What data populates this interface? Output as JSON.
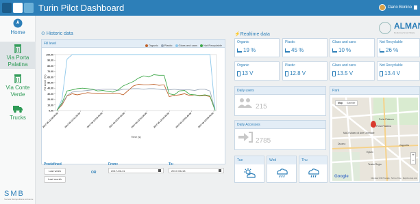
{
  "app": {
    "title": "Turin Pilot Dashboard",
    "user_name": "Dario Bonino"
  },
  "sidebar": {
    "items": [
      {
        "label": "Home",
        "icon": "compass-icon"
      },
      {
        "label": "Via Porta Palatina",
        "icon": "trash-bin-icon"
      },
      {
        "label": "Via Conte Verde",
        "icon": "trash-bin-icon"
      },
      {
        "label": "Trucks",
        "icon": "truck-icon"
      }
    ],
    "footer_logo": "SMB",
    "footer_tagline": "Società Metropolitana Ambiente"
  },
  "historic": {
    "section_title": "Historic data",
    "panel_title": "Fill level",
    "predefined_label": "Predefined",
    "btn_last_week": "Last week",
    "btn_last_month": "Last month",
    "or_label": "OR",
    "from_label": "From:",
    "to_label": "To:",
    "from_value": "2017-06-11",
    "to_value": "2017-06-13"
  },
  "chart_data": {
    "type": "line",
    "title": "",
    "xlabel": "Time (s)",
    "ylabel": "Fill Level (%)",
    "ylim": [
      0,
      100
    ],
    "yticks": [
      "100.00",
      "90.00",
      "80.00",
      "70.00",
      "60.00",
      "50.00",
      "40.00",
      "30.00",
      "20.00",
      "10.00",
      "0.00"
    ],
    "x_tick_labels": [
      "2017-06-11T00:00:00",
      "2017-06-11T12:39:55",
      "2017-06-11T23:05:00",
      "2017-06-12T07:59:00",
      "2017-06-12T13:05:00",
      "2017-06-12T19:46:00",
      "2017-06-13T03:45:00",
      "2017-06-13T09:00:00"
    ],
    "legend_position": "top-right",
    "series": [
      {
        "name": "Organic",
        "color": "#c0622a",
        "values": [
          0,
          10,
          26,
          30,
          28,
          30,
          32,
          31,
          30,
          30,
          31,
          30,
          31,
          28,
          36,
          44,
          47,
          46,
          46,
          47,
          45,
          46,
          25,
          27,
          28,
          30,
          27,
          28,
          26,
          27,
          25,
          0
        ]
      },
      {
        "name": "Plastic",
        "color": "#9aa8b8",
        "values": [
          0,
          12,
          27,
          33,
          34,
          35,
          36,
          37,
          37,
          38,
          38,
          38,
          36,
          38,
          38,
          39,
          39,
          38,
          39,
          39,
          38,
          37,
          37,
          38,
          37,
          37,
          37,
          36,
          38,
          38,
          35,
          0
        ]
      },
      {
        "name": "Glass and cans",
        "color": "#8fc8ea",
        "values": [
          0,
          20,
          92,
          100,
          100,
          100,
          100,
          100,
          100,
          100,
          100,
          100,
          100,
          100,
          100,
          100,
          100,
          100,
          100,
          100,
          100,
          100,
          100,
          100,
          100,
          100,
          100,
          100,
          100,
          100,
          100,
          0
        ]
      },
      {
        "name": "Not Recyclable",
        "color": "#3fa84a",
        "values": [
          0,
          14,
          35,
          37,
          39,
          40,
          39,
          38,
          35,
          36,
          34,
          33,
          37,
          44,
          48,
          52,
          58,
          62,
          60,
          64,
          63,
          63,
          30,
          28,
          35,
          36,
          29,
          28,
          27,
          28,
          26,
          0
        ]
      }
    ]
  },
  "realtime": {
    "section_title": "Realtime data",
    "fill": [
      {
        "label": "Organic",
        "value": "19 %"
      },
      {
        "label": "Plastic",
        "value": "45 %"
      },
      {
        "label": "Glass and cans",
        "value": "10 %"
      },
      {
        "label": "Not Recyclable",
        "value": "26 %"
      }
    ],
    "voltage": [
      {
        "label": "Organic",
        "value": "13 V"
      },
      {
        "label": "Plastic",
        "value": "12.8 V"
      },
      {
        "label": "Glass and cans",
        "value": "13.5 V"
      },
      {
        "label": "Not Recyclable",
        "value": "13.4 V"
      }
    ],
    "daily_users_title": "Daily users",
    "daily_users_value": "215",
    "daily_accesses_title": "Daily Accesses",
    "daily_accesses_value": "2785",
    "weather": [
      {
        "day": "Tue",
        "icon": "sun-cloud-icon"
      },
      {
        "day": "Wed",
        "icon": "rain-icon"
      },
      {
        "day": "Thu",
        "icon": "rain-icon"
      }
    ],
    "map_title": "Park",
    "map_tab_map": "Map",
    "map_tab_satellite": "Satellite",
    "map_labels": [
      "Porta Palazzo",
      "Porta Palatina",
      "MAO Museo di Arte Orientale",
      "Duomo",
      "Egizio",
      "Teatro Regio",
      "Cappella"
    ],
    "map_google": "Google",
    "map_footer": "Map data ©2017 Google · Terms of Use · Report a map error"
  },
  "almanac": {
    "word": "ALMANAC",
    "tagline": "Reducing Smart Waste"
  },
  "colors": {
    "brand": "#2d7fb8",
    "green": "#2d9a55",
    "header_bg": "#e3edf6"
  }
}
